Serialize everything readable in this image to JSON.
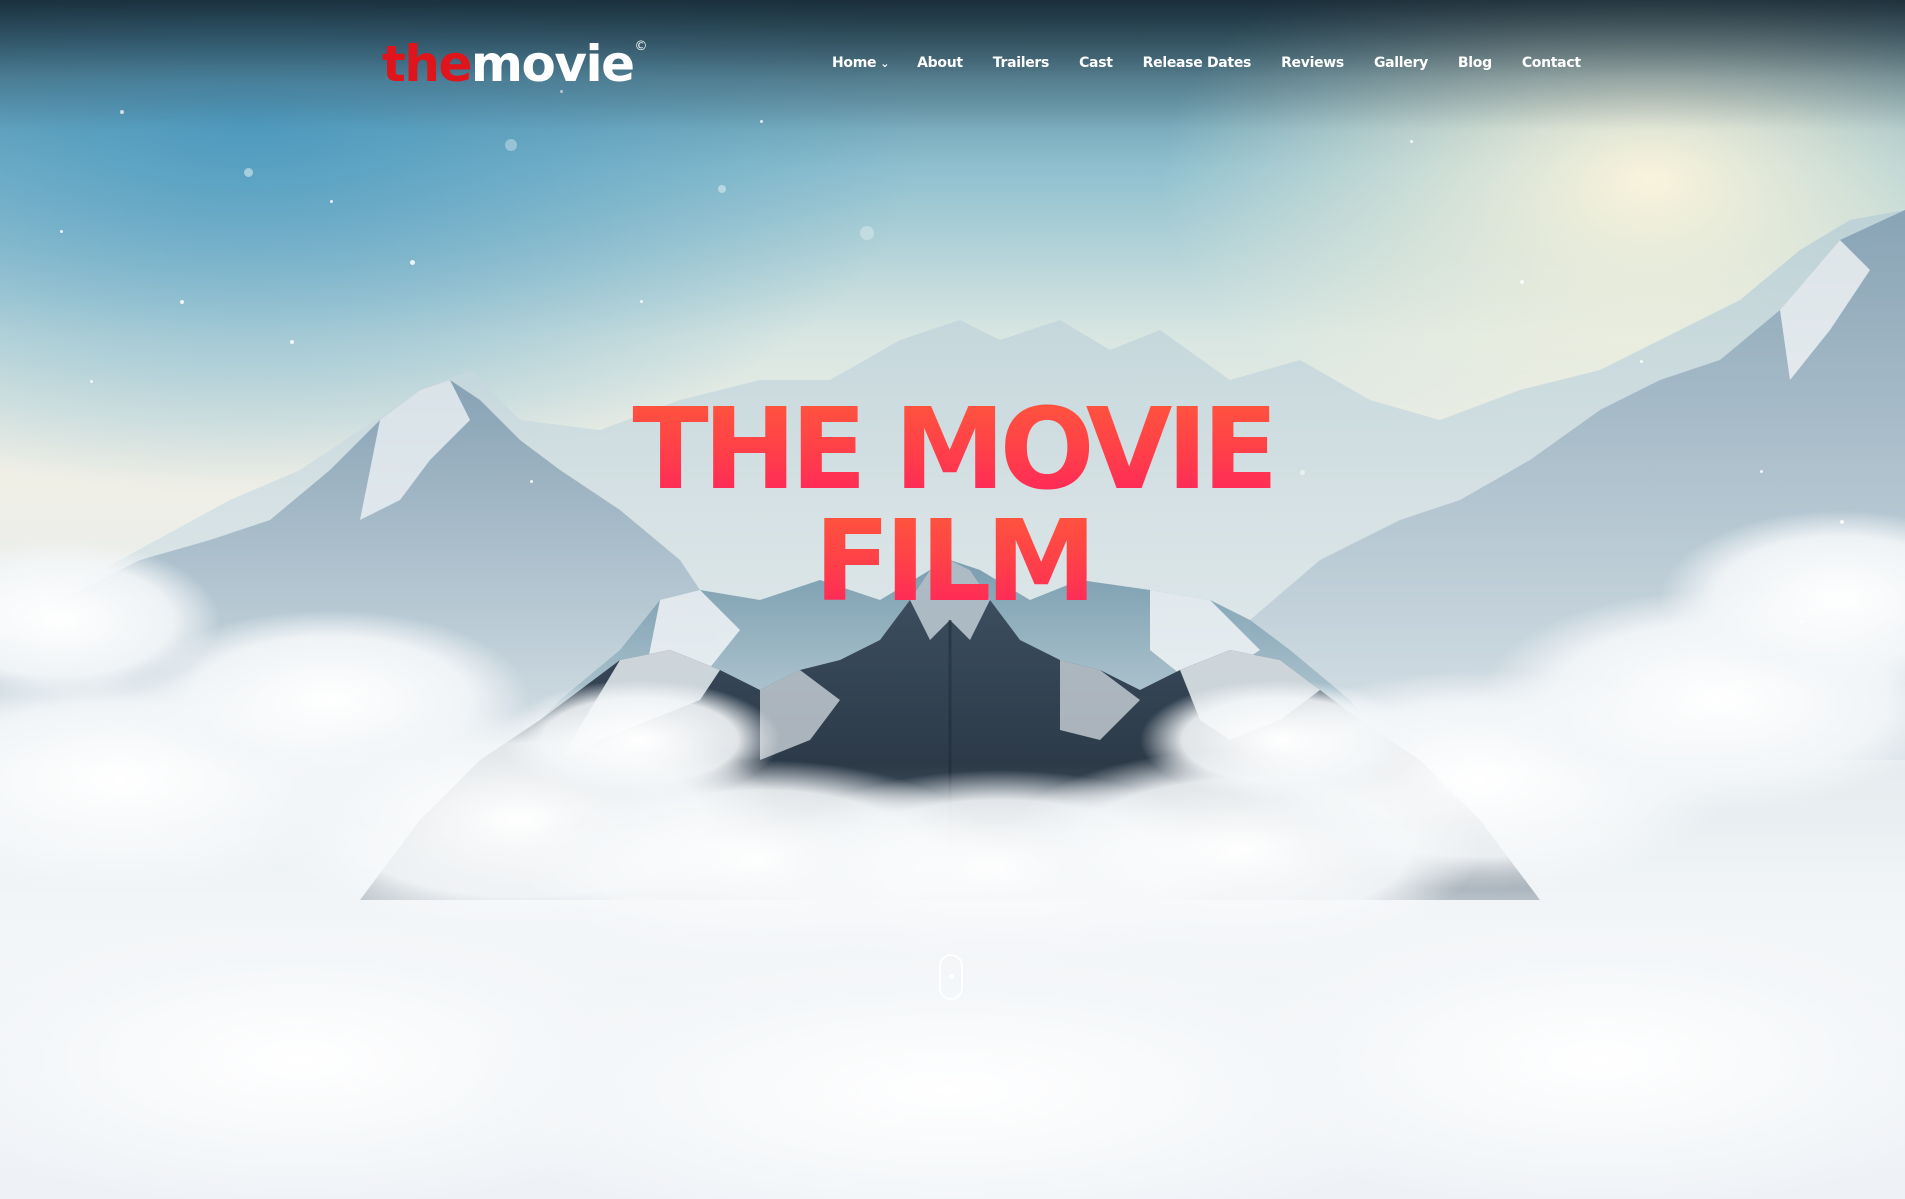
{
  "brand": {
    "logo_part1": "the",
    "logo_part2": "movie",
    "logo_mark": "©",
    "primary_color": "#e0141b"
  },
  "nav": {
    "items": [
      {
        "label": "Home",
        "has_dropdown": true,
        "icon": "chevron-down-icon"
      },
      {
        "label": "About"
      },
      {
        "label": "Trailers"
      },
      {
        "label": "Cast"
      },
      {
        "label": "Release Dates"
      },
      {
        "label": "Reviews"
      },
      {
        "label": "Gallery"
      },
      {
        "label": "Blog"
      },
      {
        "label": "Contact"
      }
    ],
    "text_color": "#ffffff"
  },
  "hero": {
    "title_line1": "THE MOVIE",
    "title_line2": "FILM",
    "title_colors": [
      "#ff5a3a",
      "#ff2060"
    ],
    "scroll_indicator_icon": "mouse-scroll-icon"
  }
}
